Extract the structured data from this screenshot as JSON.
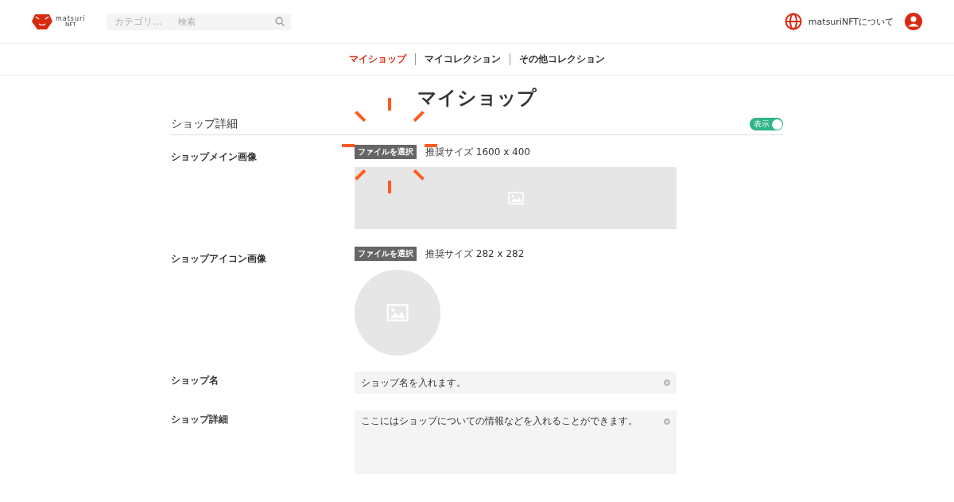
{
  "header": {
    "logo": {
      "line1": "matsuri",
      "line2": "NFT"
    },
    "search": {
      "category": "カテゴリ...",
      "placeholder": "検索"
    },
    "about_link": "matsuriNFTについて"
  },
  "nav_tabs": [
    {
      "label": "マイショップ",
      "selected": true
    },
    {
      "label": "マイコレクション",
      "selected": false
    },
    {
      "label": "その他コレクション",
      "selected": false
    }
  ],
  "page_title": "マイショップ",
  "section": {
    "title": "ショップ詳細",
    "visibility_toggle": {
      "label": "表示",
      "on": true
    }
  },
  "rows": [
    {
      "kind": "banner",
      "label": "ショップメイン画像",
      "button": "ファイルを選択",
      "hint": "推奨サイズ 1600 x 400"
    },
    {
      "kind": "icon",
      "label": "ショップアイコン画像",
      "button": "ファイルを選択",
      "hint": "推奨サイズ 282 x 282"
    },
    {
      "kind": "text",
      "label": "ショップ名",
      "value": "ショップ名を入れます。"
    },
    {
      "kind": "textarea",
      "label": "ショップ詳細",
      "value": "ここにはショップについての情報などを入れることができます。"
    }
  ]
}
